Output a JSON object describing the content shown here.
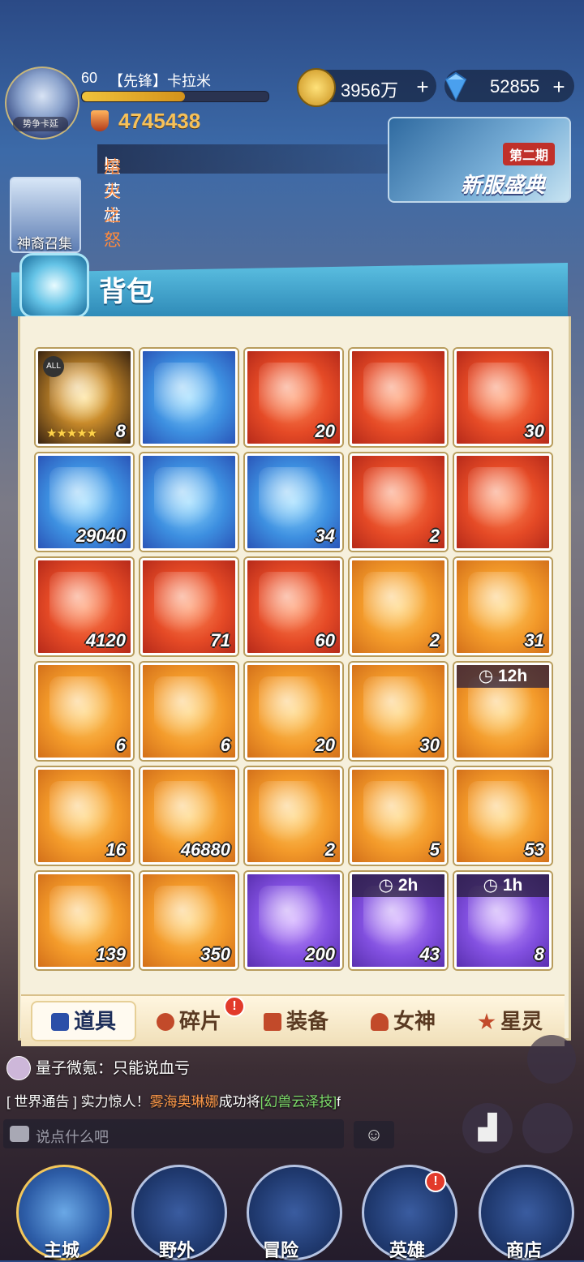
{
  "player": {
    "level": "60",
    "name": "【先锋】卡拉米",
    "avatar_tag": "势争卡延",
    "power": "4745438"
  },
  "currency": {
    "gold": "3956万",
    "gems": "52855",
    "plus": "+"
  },
  "notice": {
    "prefix": "星英雄",
    "highlight": "熔火之怒",
    "suffix": "!"
  },
  "event": {
    "badge": "第二期",
    "title": "新服盛典"
  },
  "summon_label": "神裔召集",
  "bag": {
    "title": "背包",
    "items": [
      {
        "count": "8",
        "bg": "bg-dark",
        "stars": "★★★★★",
        "all": "ALL"
      },
      {
        "count": "",
        "bg": "bg-blue"
      },
      {
        "count": "20",
        "bg": "bg-red"
      },
      {
        "count": "",
        "bg": "bg-red"
      },
      {
        "count": "30",
        "bg": "bg-red"
      },
      {
        "count": "29040",
        "bg": "bg-blue"
      },
      {
        "count": "",
        "bg": "bg-blue"
      },
      {
        "count": "34",
        "bg": "bg-blue"
      },
      {
        "count": "2",
        "bg": "bg-red"
      },
      {
        "count": "",
        "bg": "bg-red"
      },
      {
        "count": "4120",
        "bg": "bg-red"
      },
      {
        "count": "71",
        "bg": "bg-red"
      },
      {
        "count": "60",
        "bg": "bg-red"
      },
      {
        "count": "2",
        "bg": "bg-orange"
      },
      {
        "count": "31",
        "bg": "bg-orange"
      },
      {
        "count": "6",
        "bg": "bg-orange"
      },
      {
        "count": "6",
        "bg": "bg-orange"
      },
      {
        "count": "20",
        "bg": "bg-orange"
      },
      {
        "count": "30",
        "bg": "bg-orange"
      },
      {
        "count": "",
        "bg": "bg-orange",
        "timer": "12h"
      },
      {
        "count": "16",
        "bg": "bg-orange"
      },
      {
        "count": "46880",
        "bg": "bg-orange"
      },
      {
        "count": "2",
        "bg": "bg-orange"
      },
      {
        "count": "5",
        "bg": "bg-orange"
      },
      {
        "count": "53",
        "bg": "bg-orange"
      },
      {
        "count": "139",
        "bg": "bg-orange"
      },
      {
        "count": "350",
        "bg": "bg-orange"
      },
      {
        "count": "200",
        "bg": "bg-purple"
      },
      {
        "count": "43",
        "bg": "bg-purple",
        "timer": "2h"
      },
      {
        "count": "8",
        "bg": "bg-purple",
        "timer": "1h"
      }
    ]
  },
  "tabs": [
    {
      "label": "道具",
      "active": true
    },
    {
      "label": "碎片",
      "badge": "!"
    },
    {
      "label": "装备"
    },
    {
      "label": "女神"
    },
    {
      "label": "星灵"
    }
  ],
  "chat": {
    "line1": "量子微氪：只能说血亏",
    "line2_prefix": "[ 世界通告 ] 实力惊人！",
    "line2_name": "雾海奥琳娜",
    "line2_mid": "成功将",
    "line2_item": "[幻兽云泽技]",
    "line2_suffix": "f",
    "placeholder": "说点什么吧"
  },
  "nav": [
    {
      "label": "主城"
    },
    {
      "label": "野外"
    },
    {
      "label": "冒险"
    },
    {
      "label": "英雄",
      "badge": "!"
    },
    {
      "label": "商店"
    }
  ]
}
